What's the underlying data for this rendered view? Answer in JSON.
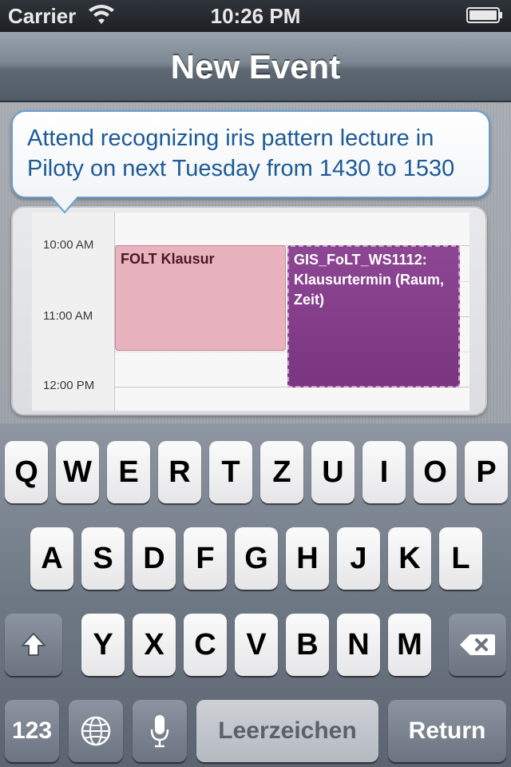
{
  "status_bar": {
    "carrier": "Carrier",
    "time": "10:26 PM",
    "wifi_icon": "wifi-icon",
    "battery_icon": "battery-icon"
  },
  "nav": {
    "title": "New Event"
  },
  "speech_bubble": {
    "text": "Attend recognizing iris pattern lecture in Piloty on next Tuesday from 1430 to 1530"
  },
  "calendar": {
    "time_labels": [
      "10:00 AM",
      "11:00 AM",
      "12:00 PM"
    ],
    "events": [
      {
        "title": "FOLT Klausur",
        "color": "#e8b3bf"
      },
      {
        "title": "GIS_FoLT_WS1112: Klausurtermin (Raum, Zeit)",
        "color": "#7f3a86"
      }
    ]
  },
  "keyboard": {
    "row1": [
      "Q",
      "W",
      "E",
      "R",
      "T",
      "Z",
      "U",
      "I",
      "O",
      "P"
    ],
    "row2": [
      "A",
      "S",
      "D",
      "F",
      "G",
      "H",
      "J",
      "K",
      "L"
    ],
    "row3": [
      "Y",
      "X",
      "C",
      "V",
      "B",
      "N",
      "M"
    ],
    "numbers_key": "123",
    "space_key": "Leerzeichen",
    "return_key": "Return",
    "shift_icon": "shift-icon",
    "delete_icon": "delete-icon",
    "globe_icon": "globe-icon",
    "mic_icon": "microphone-icon"
  }
}
